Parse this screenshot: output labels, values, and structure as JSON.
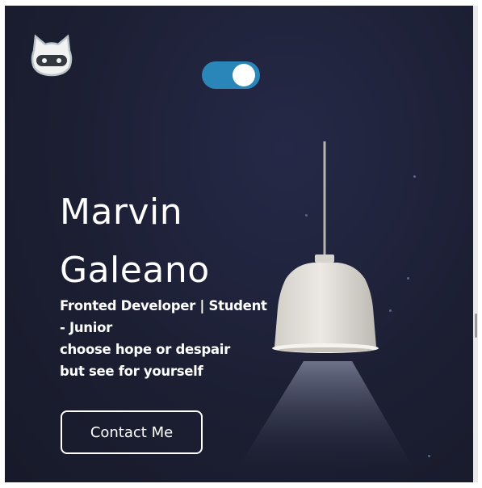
{
  "hero": {
    "name_line1": "Marvin",
    "name_line2": "Galeano",
    "subtitle_line1": "Fronted Developer | Student",
    "subtitle_line2": "- Junior",
    "subtitle_line3": "choose hope or despair",
    "subtitle_line4": "but see for yourself"
  },
  "contact": {
    "label": "Contact Me"
  },
  "theme_toggle": {
    "state": "on",
    "color": "#2a86b8"
  },
  "logo": {
    "icon": "cat-mascot-icon"
  },
  "colors": {
    "background": "#1c1f33",
    "text": "#ffffff",
    "lamp_shade": "#e6e3de"
  }
}
